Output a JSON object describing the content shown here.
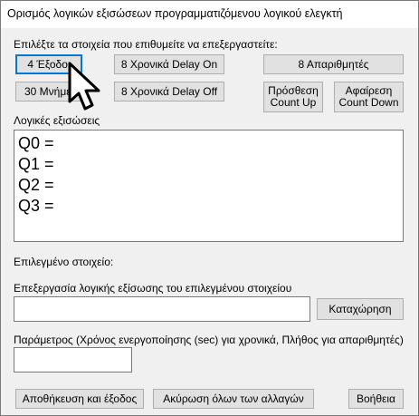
{
  "window": {
    "title": "Ορισμός λογικών εξισώσεων προγραμματιζόμενου λογικού ελεγκτή"
  },
  "elements_section": {
    "label": "Επιλέξτε τα στοιχεία που επιθυμείτε να επεξεργαστείτε:",
    "outputs_button": "4 Έξοδοι",
    "memories_button": "30 Μνήμες",
    "timer_on_button": "8 Χρονικά Delay On",
    "timer_off_button": "8 Χρονικά Delay Off",
    "counters_button": "8 Απαριθμητές",
    "count_up_button_line1": "Πρόσθεση",
    "count_up_button_line2": "Count Up",
    "count_down_button_line1": "Αφαίρεση",
    "count_down_button_line2": "Count Down"
  },
  "equations": {
    "label": "Λογικές εξισώσεις",
    "lines": [
      "Q0 =",
      "Q1 =",
      "Q2 =",
      "Q3 ="
    ]
  },
  "selected_element": {
    "label": "Επιλεγμένο στοιχείο:"
  },
  "edit_equation": {
    "label": "Επεξεργασία λογικής εξίσωσης του επιλεγμένου στοιχείου",
    "value": "",
    "register_button": "Καταχώρηση"
  },
  "parameter": {
    "label": "Παράμετρος (Χρόνος ενεργοποίησης (sec) για χρονικά, Πλήθος για απαριθμητές)",
    "value": ""
  },
  "footer": {
    "save_exit_button": "Αποθήκευση και έξοδος",
    "cancel_all_button": "Ακύρωση όλων των αλλαγών",
    "help_button": "Βοήθεια"
  },
  "colors": {
    "window_bg": "#f0f0f0",
    "button_bg": "#e1e1e1",
    "focus_border": "#0078d7"
  },
  "icons": {
    "cursor": "mouse-pointer-icon"
  }
}
